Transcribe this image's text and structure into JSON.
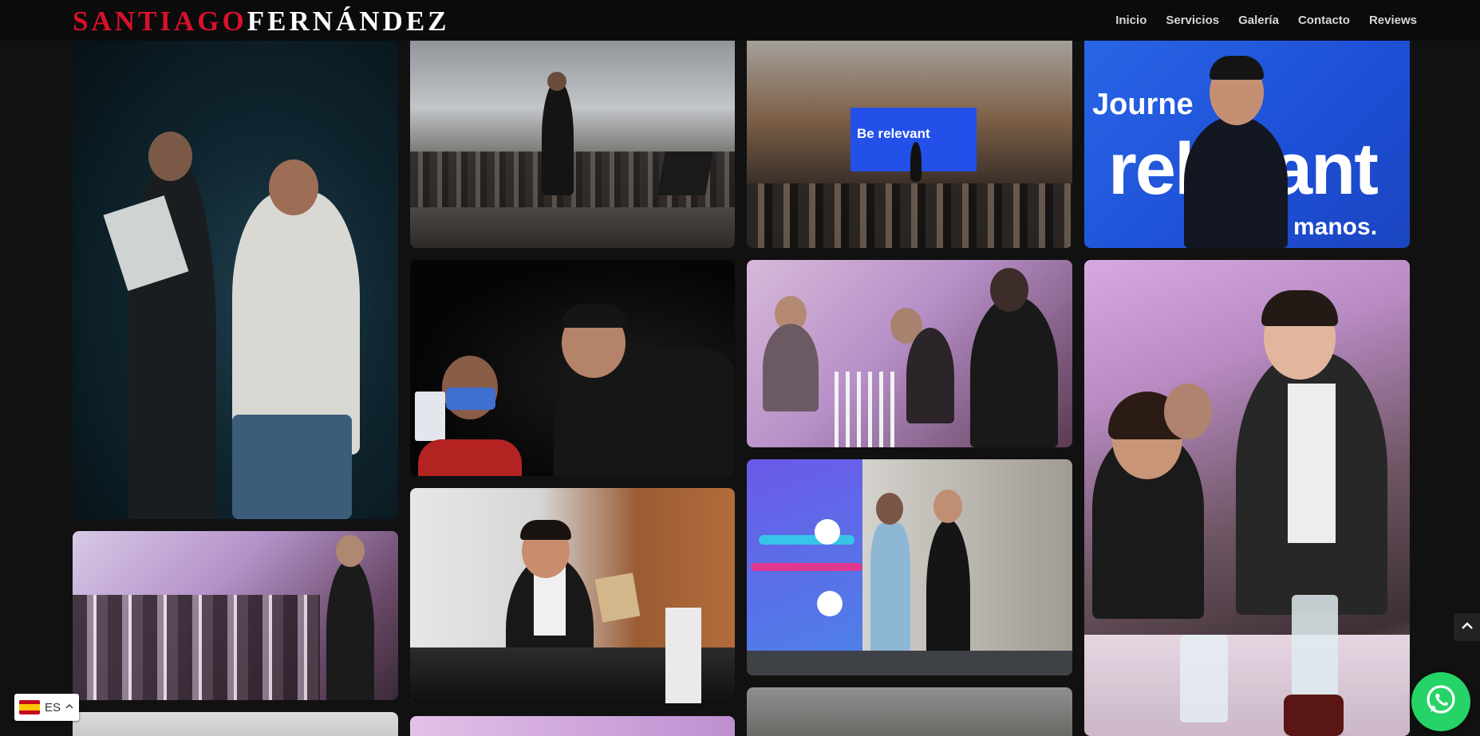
{
  "header": {
    "logo_first": "SANTIAGO",
    "logo_last": "FERNÁNDEZ",
    "nav": [
      "Inicio",
      "Servicios",
      "Galería",
      "Contacto",
      "Reviews"
    ]
  },
  "gallery": {
    "tiles": [
      {
        "id": "stage-card-reveal",
        "screen_text": ""
      },
      {
        "id": "hall-audience"
      },
      {
        "id": "stage-screen",
        "screen_text": "Be relevant"
      },
      {
        "id": "blue-backdrop-speaker",
        "backdrop_text": [
          "Journe",
          "relevant",
          "manos."
        ]
      },
      {
        "id": "card-trick-spotlight"
      },
      {
        "id": "dinner-applause"
      },
      {
        "id": "dinner-table-trick"
      },
      {
        "id": "dinner-room-wide"
      },
      {
        "id": "stage-presentation"
      },
      {
        "id": "volunteer-stage"
      }
    ]
  },
  "language": {
    "code": "ES",
    "flag": "spain-flag-icon"
  },
  "colors": {
    "logo_red": "#d8112a",
    "whatsapp_green": "#25d366",
    "background": "#111111"
  }
}
